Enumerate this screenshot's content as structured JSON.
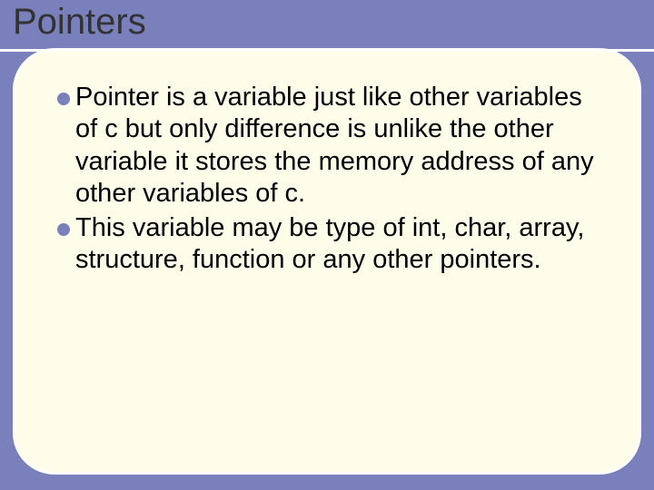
{
  "slide": {
    "title": "Pointers",
    "bullets": [
      "Pointer is a variable just like other variables of c but only difference is unlike the other variable it stores the memory address of any other variables of c.",
      "This variable may be type of int, char, array, structure, function or any other pointers."
    ]
  }
}
